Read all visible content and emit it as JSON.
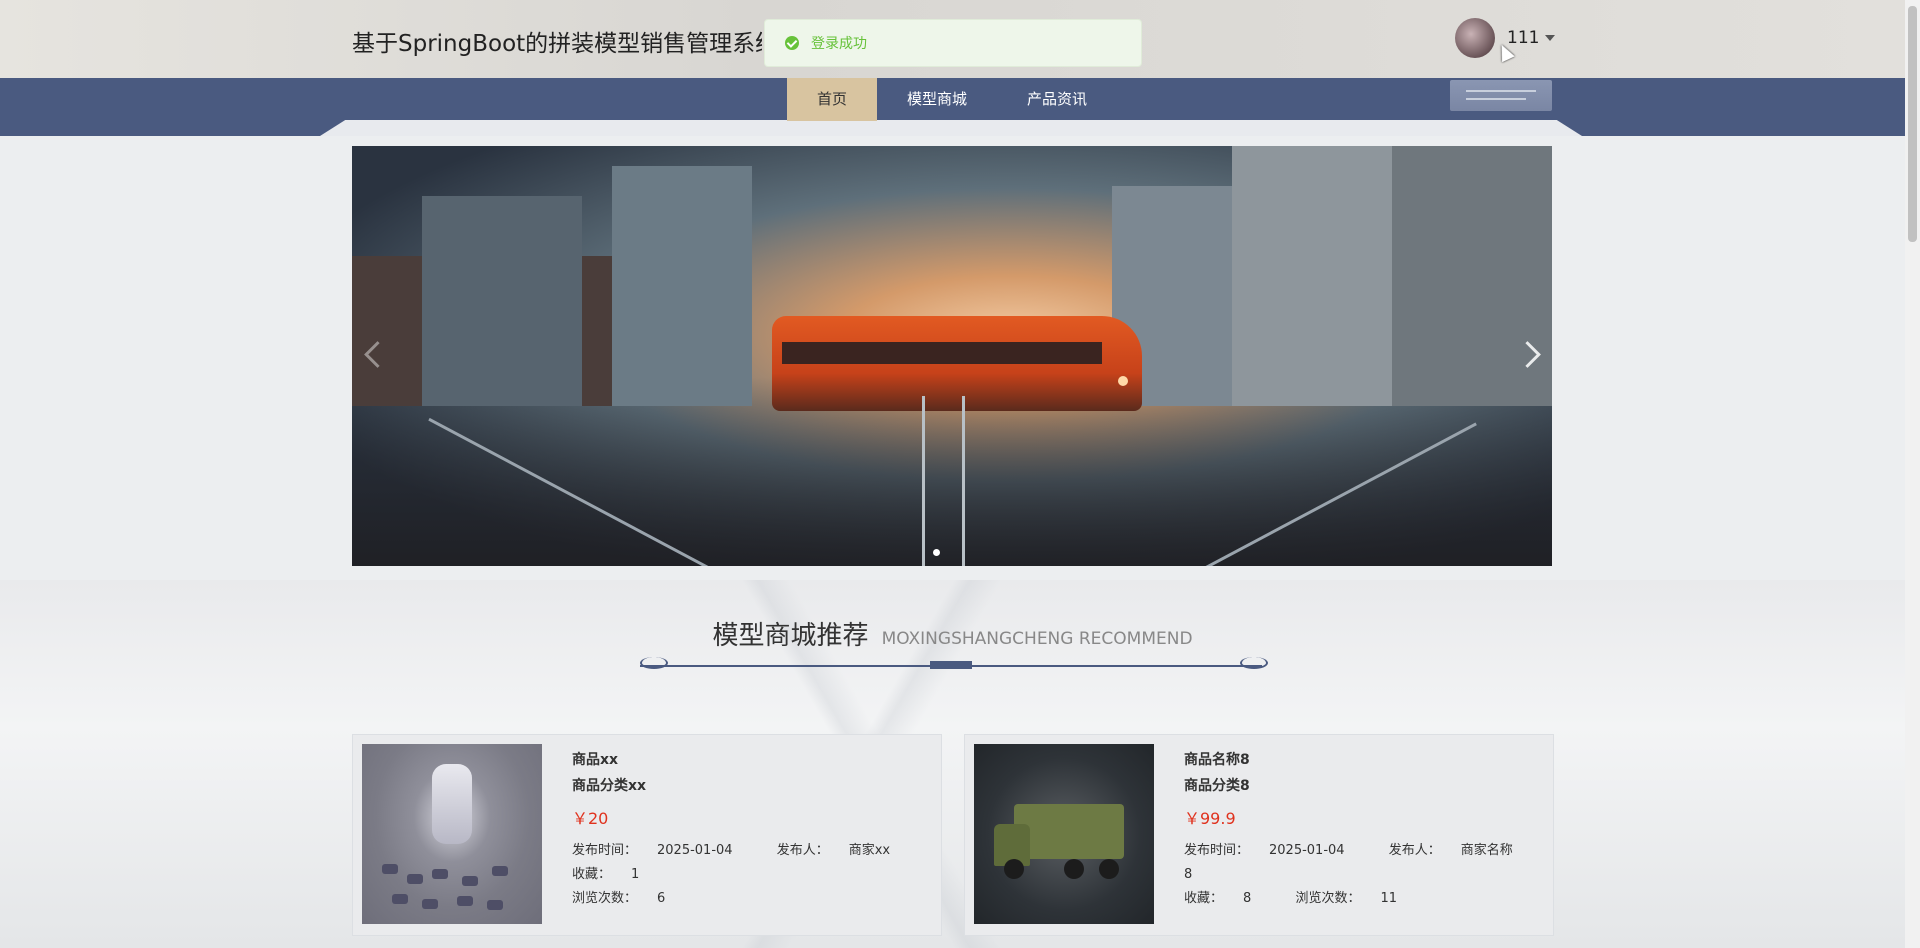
{
  "header": {
    "site_title": "基于SpringBoot的拼装模型销售管理系统的",
    "toast_message": "登录成功",
    "username": "111"
  },
  "nav": {
    "items": [
      {
        "label": "首页",
        "active": true
      },
      {
        "label": "模型商城",
        "active": false
      },
      {
        "label": "产品资讯",
        "active": false
      }
    ]
  },
  "carousel": {
    "slide_count": 1,
    "active_index": 0
  },
  "section": {
    "title_zh": "模型商城推荐",
    "title_en": "MOXINGSHANGCHENG RECOMMEND"
  },
  "products": [
    {
      "name": "商品xx",
      "category": "商品分类xx",
      "price": "￥20",
      "publish_time_label": "发布时间：",
      "publish_time": "2025-01-04",
      "publisher_label": "发布人：",
      "publisher": "商家xx",
      "favorites_label": "收藏：",
      "favorites": "1",
      "views_label": "浏览次数：",
      "views": "6",
      "image_icon": "robot-model"
    },
    {
      "name": "商品名称8",
      "category": "商品分类8",
      "price": "￥99.9",
      "publish_time_label": "发布时间：",
      "publish_time": "2025-01-04",
      "publisher_label": "发布人：",
      "publisher": "商家名称8",
      "favorites_label": "收藏：",
      "favorites": "8",
      "views_label": "浏览次数：",
      "views": "11",
      "image_icon": "truck-model"
    }
  ],
  "colors": {
    "nav_bg": "#4a5a80",
    "nav_active_bg": "#d8c4a0",
    "price": "#e0321e",
    "success": "#67c23a"
  }
}
